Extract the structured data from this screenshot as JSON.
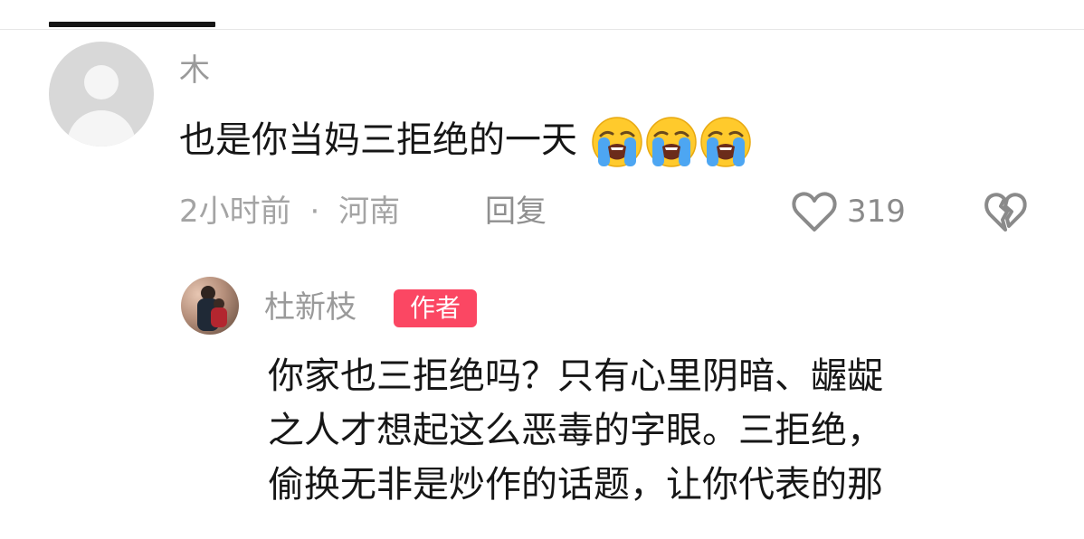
{
  "comment": {
    "username": "木",
    "text": "也是你当妈三拒绝的一天",
    "emoji_count": 3,
    "emoji_name": "loudly-crying-face",
    "time": "2小时前",
    "separator": "·",
    "location": "河南",
    "reply_label": "回复",
    "like_count": "319"
  },
  "reply": {
    "username": "杜新枝",
    "badge": "作者",
    "lines": [
      "你家也三拒绝吗？只有心里阴暗、龌龊",
      "之人才想起这么恶毒的字眼。三拒绝，",
      "偷换无非是炒作的话题，让你代表的那"
    ]
  },
  "colors": {
    "primary_text": "#161616",
    "secondary_text": "#9a9a9a",
    "badge_bg": "#fb4763",
    "tab_indicator": "#161616"
  },
  "icons": {
    "like": "heart-outline-icon",
    "dislike": "broken-heart-icon",
    "avatar_default": "default-avatar-icon"
  }
}
